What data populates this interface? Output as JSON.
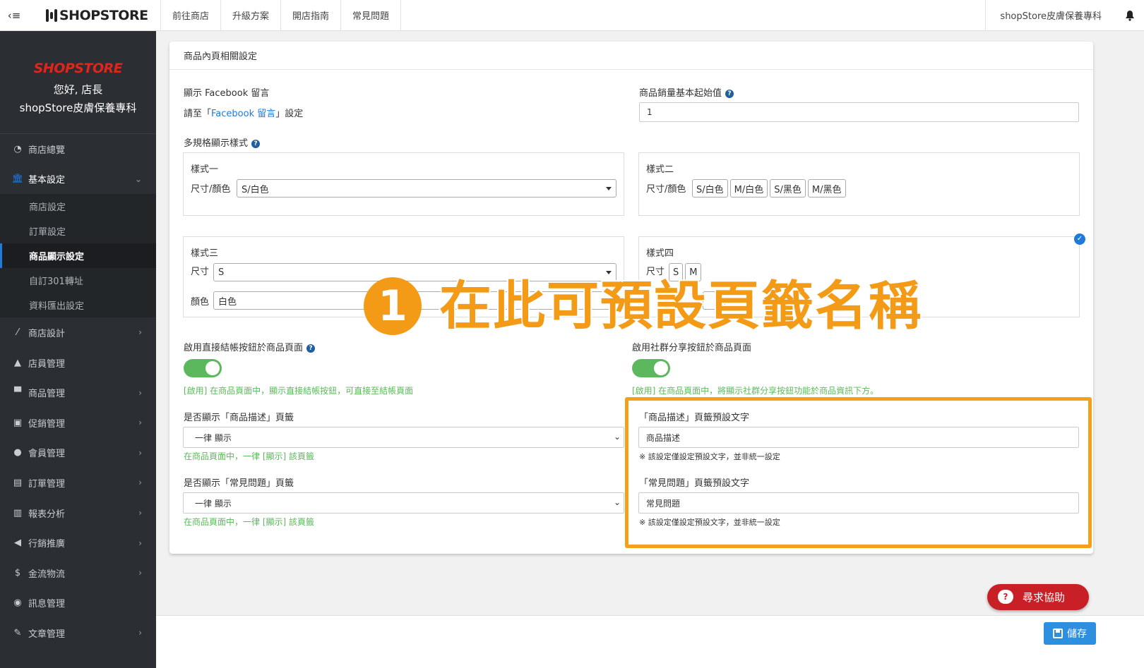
{
  "topbar": {
    "menu_icon": "‹≡",
    "logo_text": "SHOPSTORE",
    "nav": [
      "前往商店",
      "升級方案",
      "開店指南",
      "常見問題"
    ],
    "shop_name": "shopStore皮膚保養專科"
  },
  "sidebar": {
    "logo_text": "SHOPSTORE",
    "greeting": "您好, 店長",
    "store_name": "shopStore皮膚保養專科",
    "items": [
      {
        "label": "商店總覽",
        "icon": "dashboard-icon"
      },
      {
        "label": "基本設定",
        "icon": "bank-icon"
      },
      {
        "label": "商店設計",
        "icon": "wand-icon"
      },
      {
        "label": "店員管理",
        "icon": "clerk-icon"
      },
      {
        "label": "商品管理",
        "icon": "cart-icon"
      },
      {
        "label": "促銷管理",
        "icon": "gift-icon"
      },
      {
        "label": "會員管理",
        "icon": "users-icon"
      },
      {
        "label": "訂單管理",
        "icon": "orders-icon"
      },
      {
        "label": "報表分析",
        "icon": "chart-icon"
      },
      {
        "label": "行銷推廣",
        "icon": "megaphone-icon"
      },
      {
        "label": "金流物流",
        "icon": "dollar-icon"
      },
      {
        "label": "訊息管理",
        "icon": "chat-icon"
      },
      {
        "label": "文章管理",
        "icon": "edit-icon"
      }
    ],
    "subitems": [
      "商店設定",
      "訂單設定",
      "商品顯示設定",
      "自訂301轉址",
      "資料匯出設定"
    ]
  },
  "panel": {
    "title": "商品內頁相關設定",
    "fb_label": "顯示 Facebook 留言",
    "fb_note_prefix": "請至「",
    "fb_note_link": "Facebook 留言",
    "fb_note_suffix": "」設定",
    "sales_label": "商品銷量基本起始值",
    "sales_value": "1",
    "multi_label": "多規格顯示樣式",
    "style1": {
      "title": "樣式一",
      "row_label": "尺寸/顏色",
      "value": "S/白色"
    },
    "style2": {
      "title": "樣式二",
      "row_label": "尺寸/顏色",
      "chips": [
        "S/白色",
        "M/白色",
        "S/黑色",
        "M/黑色"
      ]
    },
    "style3": {
      "title": "樣式三",
      "size_label": "尺寸",
      "size_value": "S",
      "color_label": "顏色",
      "color_value": "白色"
    },
    "style4": {
      "title": "樣式四",
      "size_label": "尺寸",
      "size_chips": [
        "S",
        "M"
      ]
    },
    "checkout_label": "啟用直接結帳按鈕於商品頁面",
    "checkout_hint": "[啟用] 在商品頁面中，顯示直接結帳按鈕，可直接至結帳頁面",
    "social_label": "啟用社群分享按鈕於商品頁面",
    "social_hint": "[啟用] 在商品頁面中，將顯示社群分享按鈕功能於商品資訊下方。",
    "desc_tab_label": "是否顯示「商品描述」頁籤",
    "desc_tab_value": "一律 顯示",
    "desc_tab_hint": "在商品頁面中，一律 [顯示] 該頁籤",
    "faq_tab_label": "是否顯示「常見問題」頁籤",
    "faq_tab_value": "一律 顯示",
    "faq_tab_hint": "在商品頁面中，一律 [顯示] 該頁籤",
    "desc_text_label": "「商品描述」頁籤預設文字",
    "desc_text_value": "商品描述",
    "desc_text_note": "※ 該設定僅設定預設文字，並非統一設定",
    "faq_text_label": "「常見問題」頁籤預設文字",
    "faq_text_value": "常見問題",
    "faq_text_note": "※ 該設定僅設定預設文字，並非統一設定"
  },
  "annotation": {
    "number": "1",
    "text": "在此可預設頁籤名稱",
    "color": "#f39a16"
  },
  "buttons": {
    "help": "尋求協助",
    "save": "儲存"
  }
}
